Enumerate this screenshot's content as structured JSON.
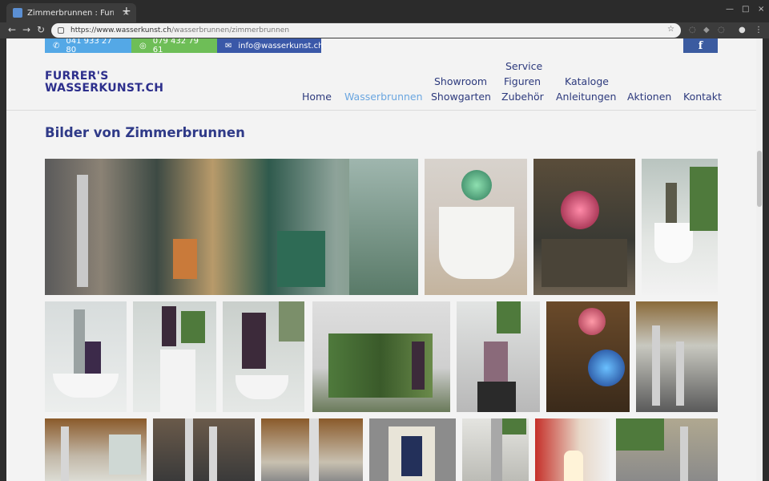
{
  "browser": {
    "tab_title": "Zimmerbrunnen : Furrer's",
    "url_host": "https://www.wasserkunst.ch",
    "url_path": "/wasserbrunnen/zimmerbrunnen"
  },
  "contact": {
    "phone": "041 933 27 80",
    "mobile": "079 432 79 61",
    "email": "info@wasserkunst.ch",
    "facebook": "f"
  },
  "logo": {
    "line1": "FURRER'S",
    "line2": "WASSERKUNST.CH"
  },
  "nav": {
    "home": "Home",
    "wasserbrunnen": "Wasserbrunnen",
    "showroom": "Showroom",
    "showgarten": "Showgarten",
    "service": "Service",
    "figuren": "Figuren",
    "zubehoer": "Zubehör",
    "kataloge": "Kataloge",
    "anleitungen": "Anleitungen",
    "aktionen": "Aktionen",
    "kontakt": "Kontakt"
  },
  "page": {
    "heading": "Bilder von Zimmerbrunnen"
  },
  "colors": {
    "phone_bg": "#54a8e6",
    "mobile_bg": "#6ebe57",
    "mail_bg": "#3a58a8",
    "nav_text": "#2d3a7d",
    "nav_active": "#6aa6e0"
  }
}
